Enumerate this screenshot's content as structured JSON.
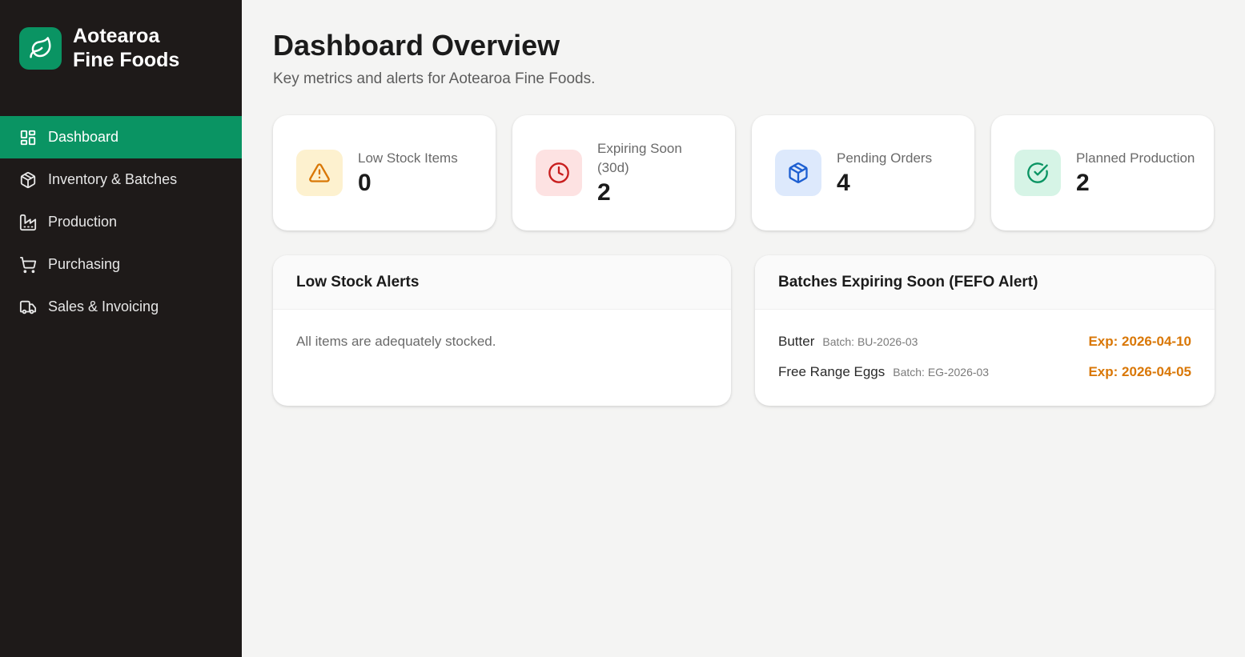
{
  "brand": {
    "line1": "Aotearoa",
    "line2": "Fine Foods",
    "logo_icon": "leaf-icon",
    "color": "#0a9463"
  },
  "sidebar": {
    "items": [
      {
        "label": "Dashboard",
        "icon": "dashboard-grid-icon",
        "active": true
      },
      {
        "label": "Inventory & Batches",
        "icon": "package-icon",
        "active": false
      },
      {
        "label": "Production",
        "icon": "factory-icon",
        "active": false
      },
      {
        "label": "Purchasing",
        "icon": "shopping-cart-icon",
        "active": false
      },
      {
        "label": "Sales & Invoicing",
        "icon": "truck-icon",
        "active": false
      }
    ]
  },
  "header": {
    "title": "Dashboard Overview",
    "subtitle": "Key metrics and alerts for Aotearoa Fine Foods."
  },
  "stats": [
    {
      "label": "Low Stock Items",
      "value": "0",
      "icon": "warning-icon",
      "icon_color": "#d97706",
      "bg": "#fdf1cf"
    },
    {
      "label": "Expiring Soon (30d)",
      "value": "2",
      "icon": "clock-icon",
      "icon_color": "#c81e1e",
      "bg": "#fde2e2"
    },
    {
      "label": "Pending Orders",
      "value": "4",
      "icon": "box-icon",
      "icon_color": "#1d5fd1",
      "bg": "#dde9fc"
    },
    {
      "label": "Planned Production",
      "value": "2",
      "icon": "check-circle-icon",
      "icon_color": "#0a9463",
      "bg": "#d6f4e6"
    }
  ],
  "low_stock_panel": {
    "title": "Low Stock Alerts",
    "empty_message": "All items are adequately stocked."
  },
  "expiring_panel": {
    "title": "Batches Expiring Soon (FEFO Alert)",
    "rows": [
      {
        "name": "Butter",
        "batch": "Batch: BU-2026-03",
        "expiry": "Exp: 2026-04-10"
      },
      {
        "name": "Free Range Eggs",
        "batch": "Batch: EG-2026-03",
        "expiry": "Exp: 2026-04-05"
      }
    ],
    "expiry_color": "#d97706"
  }
}
